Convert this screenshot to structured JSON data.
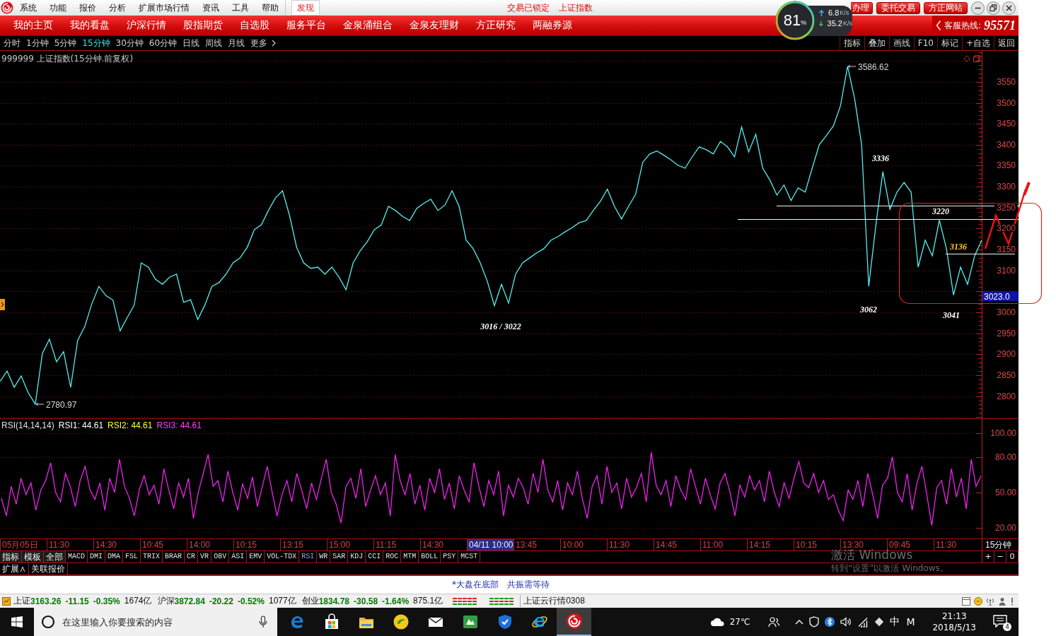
{
  "title_bar": {
    "menu": [
      "系统",
      "功能",
      "报价",
      "分析",
      "扩展市场行情",
      "资讯",
      "工具",
      "帮助"
    ],
    "discover": "发现",
    "trade_status": "交易已锁定",
    "security": "上证指数",
    "buttons": [
      "办理",
      "委托交易",
      "方正网站"
    ]
  },
  "speed_widget": {
    "percent": "81",
    "percent_unit": "%",
    "upload": "6.8",
    "upload_unit": "K/s",
    "download": "35.2",
    "download_unit": "K/s"
  },
  "nav_bar": {
    "items": [
      "我的主页",
      "我的看盘",
      "沪深行情",
      "股指期货",
      "自选股",
      "服务平台",
      "金泉涌组合",
      "金泉友理财",
      "方正研究",
      "两融券源"
    ],
    "hotline_label": "客服热线:",
    "hotline_number": "95571"
  },
  "period_bar": {
    "periods": [
      {
        "label": "分时",
        "selected": false
      },
      {
        "label": "1分钟",
        "selected": false
      },
      {
        "label": "5分钟",
        "selected": false
      },
      {
        "label": "15分钟",
        "selected": true
      },
      {
        "label": "30分钟",
        "selected": false
      },
      {
        "label": "60分钟",
        "selected": false
      },
      {
        "label": "日线",
        "selected": false
      },
      {
        "label": "周线",
        "selected": false
      },
      {
        "label": "月线",
        "selected": false
      }
    ],
    "more": "更多",
    "tools": [
      "指标",
      "叠加",
      "画线",
      "F10",
      "标记",
      "+自选",
      "返回"
    ]
  },
  "price_chart": {
    "chart_data": {
      "type": "line",
      "title": "999999 上证指数(15分钟.前复权)",
      "ylim": [
        2747,
        3624
      ],
      "yticks": [
        3550,
        3500,
        3450,
        3400,
        3350,
        3300,
        3250,
        3200,
        3150,
        3100,
        3000,
        2950,
        2900,
        2850,
        2800
      ],
      "grid": true,
      "series": [
        {
          "color": "#55eeee",
          "values": [
            2835,
            2860,
            2821,
            2848,
            2808,
            2781,
            2902,
            2936,
            2882,
            2906,
            2821,
            2933,
            2966,
            3020,
            3062,
            3040,
            3029,
            2956,
            2987,
            3017,
            3118,
            3108,
            3079,
            3067,
            3084,
            3091,
            3024,
            3030,
            2983,
            3017,
            3062,
            3071,
            3091,
            3118,
            3130,
            3155,
            3197,
            3209,
            3243,
            3273,
            3290,
            3231,
            3155,
            3118,
            3105,
            3108,
            3091,
            3108,
            3084,
            3054,
            3118,
            3147,
            3169,
            3197,
            3209,
            3253,
            3243,
            3229,
            3219,
            3248,
            3260,
            3270,
            3243,
            3256,
            3290,
            3253,
            3172,
            3152,
            3118,
            3074,
            3016,
            3067,
            3022,
            3091,
            3118,
            3130,
            3142,
            3152,
            3172,
            3181,
            3192,
            3202,
            3214,
            3219,
            3243,
            3265,
            3294,
            3253,
            3223,
            3253,
            3282,
            3358,
            3378,
            3385,
            3375,
            3364,
            3351,
            3344,
            3371,
            3395,
            3388,
            3378,
            3408,
            3395,
            3371,
            3442,
            3383,
            3425,
            3344,
            3316,
            3280,
            3304,
            3267,
            3297,
            3287,
            3344,
            3400,
            3422,
            3445,
            3493,
            3587,
            3510,
            3400,
            3062,
            3206,
            3336,
            3246,
            3287,
            3310,
            3287,
            3108,
            3172,
            3135,
            3220,
            3152,
            3041,
            3108,
            3067,
            3135,
            3172
          ]
        }
      ],
      "annotations": [
        "3586.62",
        "2780.97",
        "3016 / 3022",
        "3336",
        "3220",
        "3062",
        "3041",
        "3136",
        "3023.0"
      ]
    }
  },
  "rsi_panel": {
    "readings": [
      {
        "text": "RSI1: 44.61",
        "color": "#ffffff"
      },
      {
        "text": "RSI2: 44.61",
        "color": "#ffff30"
      },
      {
        "text": "RSI3: 44.61",
        "color": "#ff40ff"
      }
    ],
    "chart_data": {
      "type": "line",
      "title": "RSI(14,14,14)",
      "ylim": [
        11,
        112
      ],
      "yticks": [
        {
          "value": 100,
          "label": "100.00"
        },
        {
          "value": 80,
          "label": "80.00"
        },
        {
          "value": 50,
          "label": "50.00"
        },
        {
          "value": 20,
          "label": "20.00"
        }
      ],
      "grid": true,
      "series": [
        {
          "color": "#ee22ee",
          "values": [
            45,
            30,
            55,
            40,
            62,
            48,
            58,
            35,
            52,
            60,
            75,
            50,
            42,
            66,
            55,
            38,
            60,
            72,
            52,
            44,
            58,
            35,
            62,
            50,
            78,
            55,
            45,
            30,
            52,
            64,
            48,
            56,
            40,
            70,
            52,
            36,
            58,
            46,
            62,
            28,
            50,
            66,
            82,
            55,
            60,
            42,
            68,
            50,
            35,
            57,
            45,
            63,
            38,
            55,
            72,
            50,
            30,
            48,
            60,
            42,
            66,
            52,
            36,
            58,
            44,
            62,
            78,
            50,
            40,
            24,
            55,
            62,
            45,
            70,
            38,
            52,
            64,
            48,
            58,
            30,
            82,
            60,
            48,
            66,
            40,
            56,
            35,
            62,
            50,
            70,
            44,
            58,
            36,
            64,
            52,
            42,
            75,
            55,
            38,
            60,
            48,
            68,
            30,
            56,
            46,
            62,
            54,
            40,
            66,
            50,
            78,
            52,
            42,
            60,
            35,
            58,
            48,
            68,
            45,
            28,
            55,
            64,
            40,
            72,
            50,
            58,
            36,
            62,
            46,
            54,
            66,
            42,
            84,
            56,
            48,
            60,
            38,
            64,
            52,
            44,
            70,
            55,
            40,
            62,
            48,
            36,
            58,
            66,
            50,
            30,
            56,
            46,
            64,
            52,
            60,
            42,
            68,
            50,
            38,
            58,
            45,
            62,
            76,
            58,
            54,
            66,
            50,
            60,
            44,
            48,
            35,
            26,
            52,
            44,
            60,
            38,
            66,
            48,
            28,
            56,
            62,
            80,
            50,
            42,
            66,
            35,
            58,
            72,
            48,
            22,
            54,
            60,
            40,
            70,
            46,
            62,
            36,
            78,
            55,
            64
          ]
        }
      ]
    }
  },
  "time_axis": {
    "labels": [
      {
        "text": "05月05日",
        "selected": false
      },
      {
        "text": "11:30",
        "selected": false
      },
      {
        "text": "14:30",
        "selected": false
      },
      {
        "text": "10:45",
        "selected": false
      },
      {
        "text": "14:00",
        "selected": false
      },
      {
        "text": "10:15",
        "selected": false
      },
      {
        "text": "13:15",
        "selected": false
      },
      {
        "text": "15:00",
        "selected": false
      },
      {
        "text": "11:15",
        "selected": false
      },
      {
        "text": "14:30",
        "selected": false
      },
      {
        "text": "04/11 10:00",
        "selected": true
      },
      {
        "text": "13:45",
        "selected": false
      },
      {
        "text": "10:00",
        "selected": false
      },
      {
        "text": "11:30",
        "selected": false
      },
      {
        "text": "14:45",
        "selected": false
      },
      {
        "text": "11:00",
        "selected": false
      },
      {
        "text": "14:15",
        "selected": false
      },
      {
        "text": "10:15",
        "selected": false
      },
      {
        "text": "13:30",
        "selected": false
      },
      {
        "text": "09:45",
        "selected": false
      },
      {
        "text": "11:30",
        "selected": false
      }
    ],
    "period": "15分钟"
  },
  "indicator_bar": {
    "groups": [
      "指标",
      "模板",
      "全部"
    ],
    "tabs": [
      {
        "label": "MACD",
        "selected": false
      },
      {
        "label": "DMI",
        "selected": false
      },
      {
        "label": "DMA",
        "selected": false
      },
      {
        "label": "FSL",
        "selected": false
      },
      {
        "label": "TRIX",
        "selected": false
      },
      {
        "label": "BRAR",
        "selected": false
      },
      {
        "label": "CR",
        "selected": false
      },
      {
        "label": "VR",
        "selected": false
      },
      {
        "label": "OBV",
        "selected": false
      },
      {
        "label": "ASI",
        "selected": false
      },
      {
        "label": "EMV",
        "selected": false
      },
      {
        "label": "VOL-TDX",
        "selected": false
      },
      {
        "label": "RSI",
        "selected": true
      },
      {
        "label": "WR",
        "selected": false
      },
      {
        "label": "SAR",
        "selected": false
      },
      {
        "label": "KDJ",
        "selected": false
      },
      {
        "label": "CCI",
        "selected": false
      },
      {
        "label": "ROC",
        "selected": false
      },
      {
        "label": "MTM",
        "selected": false
      },
      {
        "label": "BOLL",
        "selected": false
      },
      {
        "label": "PSY",
        "selected": false
      },
      {
        "label": "MCST",
        "selected": false
      }
    ],
    "zoom_buttons": [
      "+",
      "−",
      "0"
    ]
  },
  "extension_bar": {
    "items": [
      "扩展∧",
      "关联报价"
    ]
  },
  "windows_notice": {
    "title": "激活 Windows",
    "hint": "转到“设置”以激活 Windows。"
  },
  "message_bar": {
    "messages": [
      "*大盘在底部",
      "共振需等待"
    ]
  },
  "status_bar": {
    "indices": [
      {
        "name": "上证",
        "value": "3163.26",
        "change": "-11.15",
        "percent": "-0.35%",
        "turnover": "1674亿",
        "rising": false
      },
      {
        "name": "沪深",
        "value": "3872.84",
        "change": "-20.22",
        "percent": "-0.52%",
        "turnover": "1077亿",
        "rising": false
      },
      {
        "name": "创业",
        "value": "1834.78",
        "change": "-30.58",
        "percent": "-1.64%",
        "turnover": "875.1亿",
        "rising": false
      }
    ],
    "cloud_status": "上证云行情0308"
  },
  "taskbar": {
    "search_placeholder": "在这里输入你要搜索的内容",
    "pinned_apps": [
      {
        "active": false
      },
      {
        "active": false
      },
      {
        "active": false
      },
      {
        "active": false
      },
      {
        "active": false
      },
      {
        "active": false
      },
      {
        "active": false
      },
      {
        "active": false
      },
      {
        "active": true
      }
    ],
    "temperature": "27℃",
    "ime_language": "中",
    "ime_mode": "M",
    "time": "21:13",
    "date": "2018/5/13",
    "notification_count": "4"
  }
}
